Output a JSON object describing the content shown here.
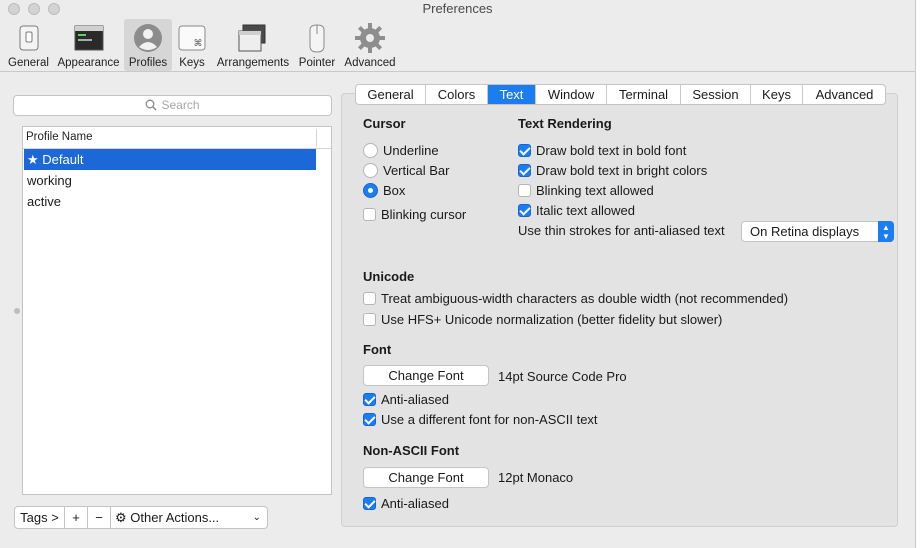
{
  "window": {
    "title": "Preferences"
  },
  "toolbar": {
    "items": [
      {
        "label": "General",
        "icon": "switch-icon"
      },
      {
        "label": "Appearance",
        "icon": "window-icon"
      },
      {
        "label": "Profiles",
        "icon": "user-icon",
        "selected": true
      },
      {
        "label": "Keys",
        "icon": "keyboard-key-icon"
      },
      {
        "label": "Arrangements",
        "icon": "window-stack-icon"
      },
      {
        "label": "Pointer",
        "icon": "mouse-icon"
      },
      {
        "label": "Advanced",
        "icon": "gear-icon"
      }
    ]
  },
  "profiles": {
    "search_placeholder": "Search",
    "column_header": "Profile Name",
    "rows": [
      {
        "label": "★ Default",
        "selected": true
      },
      {
        "label": "working"
      },
      {
        "label": "active"
      }
    ],
    "tags_button": "Tags >",
    "add_button": "+",
    "remove_button": "−",
    "other_actions": "Other Actions..."
  },
  "tabs": [
    "General",
    "Colors",
    "Text",
    "Window",
    "Terminal",
    "Session",
    "Keys",
    "Advanced"
  ],
  "active_tab": "Text",
  "cursor": {
    "title": "Cursor",
    "options": [
      {
        "label": "Underline",
        "checked": false
      },
      {
        "label": "Vertical Bar",
        "checked": false
      },
      {
        "label": "Box",
        "checked": true
      }
    ],
    "blinking": {
      "label": "Blinking cursor",
      "checked": false
    }
  },
  "text_rendering": {
    "title": "Text Rendering",
    "options": [
      {
        "label": "Draw bold text in bold font",
        "checked": true
      },
      {
        "label": "Draw bold text in bright colors",
        "checked": true
      },
      {
        "label": "Blinking text allowed",
        "checked": false
      },
      {
        "label": "Italic text allowed",
        "checked": true
      }
    ],
    "thin_strokes_label": "Use thin strokes for anti-aliased text",
    "thin_strokes_value": "On Retina displays"
  },
  "unicode": {
    "title": "Unicode",
    "options": [
      {
        "label": "Treat ambiguous-width characters as double width (not recommended)",
        "checked": false
      },
      {
        "label": "Use HFS+ Unicode normalization (better fidelity but slower)",
        "checked": false
      }
    ]
  },
  "font": {
    "title": "Font",
    "change_button": "Change Font",
    "current": "14pt Source Code Pro",
    "options": [
      {
        "label": "Anti-aliased",
        "checked": true
      },
      {
        "label": "Use a different font for non-ASCII text",
        "checked": true
      }
    ]
  },
  "non_ascii_font": {
    "title": "Non-ASCII Font",
    "change_button": "Change Font",
    "current": "12pt Monaco",
    "anti_aliased": {
      "label": "Anti-aliased",
      "checked": true
    }
  },
  "colors": {
    "accent": "#1c7cf2",
    "selection": "#1d68d8"
  }
}
